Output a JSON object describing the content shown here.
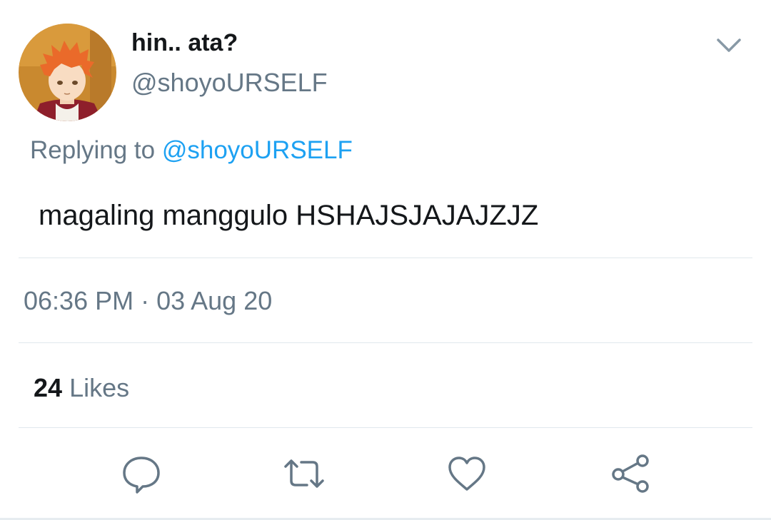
{
  "tweet": {
    "display_name": "hin.. ata?",
    "handle": "@shoyoURSELF",
    "avatar_icon": "profile-avatar",
    "reply_prefix": "Replying to",
    "reply_mention": "@shoyoURSELF",
    "text": "magaling manggulo HSHAJSJAJAJZJZ",
    "timestamp": "06:36 PM · 03 Aug 20",
    "likes_count": "24",
    "likes_label": "Likes"
  },
  "actions": [
    {
      "icon": "reply-icon"
    },
    {
      "icon": "retweet-icon"
    },
    {
      "icon": "like-heart-icon"
    },
    {
      "icon": "share-icon"
    }
  ],
  "colors": {
    "text_primary": "#14171a",
    "text_secondary": "#657786",
    "link_blue": "#1da1f2",
    "divider": "#e1e8ed",
    "icon_gray": "#657786"
  }
}
